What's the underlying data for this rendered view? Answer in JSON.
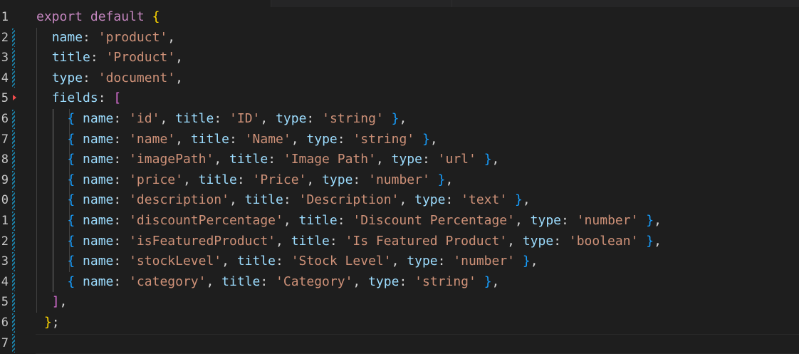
{
  "editor": {
    "language": "javascript",
    "line_numbers": [
      "1",
      "2",
      "3",
      "4",
      "5",
      "6",
      "7",
      "8",
      "9",
      "0",
      "1",
      "2",
      "3",
      "4",
      "5",
      "6",
      "7"
    ],
    "gutter_markers": [
      "none",
      "bar",
      "bar",
      "bar",
      "deleted",
      "bar",
      "bar",
      "bar",
      "bar",
      "bar",
      "bar",
      "bar",
      "bar",
      "bar",
      "bar",
      "bar",
      "bar"
    ],
    "current_line_index": 16,
    "lines": [
      [
        [
          "k",
          "export"
        ],
        [
          "pn",
          " "
        ],
        [
          "k",
          "default"
        ],
        [
          "pn",
          " "
        ],
        [
          "b1",
          "{"
        ]
      ],
      [
        [
          "pn",
          "  "
        ],
        [
          "p",
          "name"
        ],
        [
          "pn",
          ": "
        ],
        [
          "s",
          "'product'"
        ],
        [
          "pn",
          ","
        ]
      ],
      [
        [
          "pn",
          "  "
        ],
        [
          "p",
          "title"
        ],
        [
          "pn",
          ": "
        ],
        [
          "s",
          "'Product'"
        ],
        [
          "pn",
          ","
        ]
      ],
      [
        [
          "pn",
          "  "
        ],
        [
          "p",
          "type"
        ],
        [
          "pn",
          ": "
        ],
        [
          "s",
          "'document'"
        ],
        [
          "pn",
          ","
        ]
      ],
      [
        [
          "pn",
          "  "
        ],
        [
          "p",
          "fields"
        ],
        [
          "pn",
          ": "
        ],
        [
          "b2",
          "["
        ]
      ],
      [
        [
          "pn",
          "    "
        ],
        [
          "b3",
          "{"
        ],
        [
          "pn",
          " "
        ],
        [
          "p",
          "name"
        ],
        [
          "pn",
          ": "
        ],
        [
          "s",
          "'id'"
        ],
        [
          "pn",
          ", "
        ],
        [
          "p",
          "title"
        ],
        [
          "pn",
          ": "
        ],
        [
          "s",
          "'ID'"
        ],
        [
          "pn",
          ", "
        ],
        [
          "p",
          "type"
        ],
        [
          "pn",
          ": "
        ],
        [
          "s",
          "'string'"
        ],
        [
          "pn",
          " "
        ],
        [
          "b3",
          "}"
        ],
        [
          "pn",
          ","
        ]
      ],
      [
        [
          "pn",
          "    "
        ],
        [
          "b3",
          "{"
        ],
        [
          "pn",
          " "
        ],
        [
          "p",
          "name"
        ],
        [
          "pn",
          ": "
        ],
        [
          "s",
          "'name'"
        ],
        [
          "pn",
          ", "
        ],
        [
          "p",
          "title"
        ],
        [
          "pn",
          ": "
        ],
        [
          "s",
          "'Name'"
        ],
        [
          "pn",
          ", "
        ],
        [
          "p",
          "type"
        ],
        [
          "pn",
          ": "
        ],
        [
          "s",
          "'string'"
        ],
        [
          "pn",
          " "
        ],
        [
          "b3",
          "}"
        ],
        [
          "pn",
          ","
        ]
      ],
      [
        [
          "pn",
          "    "
        ],
        [
          "b3",
          "{"
        ],
        [
          "pn",
          " "
        ],
        [
          "p",
          "name"
        ],
        [
          "pn",
          ": "
        ],
        [
          "s",
          "'imagePath'"
        ],
        [
          "pn",
          ", "
        ],
        [
          "p",
          "title"
        ],
        [
          "pn",
          ": "
        ],
        [
          "s",
          "'Image Path'"
        ],
        [
          "pn",
          ", "
        ],
        [
          "p",
          "type"
        ],
        [
          "pn",
          ": "
        ],
        [
          "s",
          "'url'"
        ],
        [
          "pn",
          " "
        ],
        [
          "b3",
          "}"
        ],
        [
          "pn",
          ","
        ]
      ],
      [
        [
          "pn",
          "    "
        ],
        [
          "b3",
          "{"
        ],
        [
          "pn",
          " "
        ],
        [
          "p",
          "name"
        ],
        [
          "pn",
          ": "
        ],
        [
          "s",
          "'price'"
        ],
        [
          "pn",
          ", "
        ],
        [
          "p",
          "title"
        ],
        [
          "pn",
          ": "
        ],
        [
          "s",
          "'Price'"
        ],
        [
          "pn",
          ", "
        ],
        [
          "p",
          "type"
        ],
        [
          "pn",
          ": "
        ],
        [
          "s",
          "'number'"
        ],
        [
          "pn",
          " "
        ],
        [
          "b3",
          "}"
        ],
        [
          "pn",
          ","
        ]
      ],
      [
        [
          "pn",
          "    "
        ],
        [
          "b3",
          "{"
        ],
        [
          "pn",
          " "
        ],
        [
          "p",
          "name"
        ],
        [
          "pn",
          ": "
        ],
        [
          "s",
          "'description'"
        ],
        [
          "pn",
          ", "
        ],
        [
          "p",
          "title"
        ],
        [
          "pn",
          ": "
        ],
        [
          "s",
          "'Description'"
        ],
        [
          "pn",
          ", "
        ],
        [
          "p",
          "type"
        ],
        [
          "pn",
          ": "
        ],
        [
          "s",
          "'text'"
        ],
        [
          "pn",
          " "
        ],
        [
          "b3",
          "}"
        ],
        [
          "pn",
          ","
        ]
      ],
      [
        [
          "pn",
          "    "
        ],
        [
          "b3",
          "{"
        ],
        [
          "pn",
          " "
        ],
        [
          "p",
          "name"
        ],
        [
          "pn",
          ": "
        ],
        [
          "s",
          "'discountPercentage'"
        ],
        [
          "pn",
          ", "
        ],
        [
          "p",
          "title"
        ],
        [
          "pn",
          ": "
        ],
        [
          "s",
          "'Discount Percentage'"
        ],
        [
          "pn",
          ", "
        ],
        [
          "p",
          "type"
        ],
        [
          "pn",
          ": "
        ],
        [
          "s",
          "'number'"
        ],
        [
          "pn",
          " "
        ],
        [
          "b3",
          "}"
        ],
        [
          "pn",
          ","
        ]
      ],
      [
        [
          "pn",
          "    "
        ],
        [
          "b3",
          "{"
        ],
        [
          "pn",
          " "
        ],
        [
          "p",
          "name"
        ],
        [
          "pn",
          ": "
        ],
        [
          "s",
          "'isFeaturedProduct'"
        ],
        [
          "pn",
          ", "
        ],
        [
          "p",
          "title"
        ],
        [
          "pn",
          ": "
        ],
        [
          "s",
          "'Is Featured Product'"
        ],
        [
          "pn",
          ", "
        ],
        [
          "p",
          "type"
        ],
        [
          "pn",
          ": "
        ],
        [
          "s",
          "'boolean'"
        ],
        [
          "pn",
          " "
        ],
        [
          "b3",
          "}"
        ],
        [
          "pn",
          ","
        ]
      ],
      [
        [
          "pn",
          "    "
        ],
        [
          "b3",
          "{"
        ],
        [
          "pn",
          " "
        ],
        [
          "p",
          "name"
        ],
        [
          "pn",
          ": "
        ],
        [
          "s",
          "'stockLevel'"
        ],
        [
          "pn",
          ", "
        ],
        [
          "p",
          "title"
        ],
        [
          "pn",
          ": "
        ],
        [
          "s",
          "'Stock Level'"
        ],
        [
          "pn",
          ", "
        ],
        [
          "p",
          "type"
        ],
        [
          "pn",
          ": "
        ],
        [
          "s",
          "'number'"
        ],
        [
          "pn",
          " "
        ],
        [
          "b3",
          "}"
        ],
        [
          "pn",
          ","
        ]
      ],
      [
        [
          "pn",
          "    "
        ],
        [
          "b3",
          "{"
        ],
        [
          "pn",
          " "
        ],
        [
          "p",
          "name"
        ],
        [
          "pn",
          ": "
        ],
        [
          "s",
          "'category'"
        ],
        [
          "pn",
          ", "
        ],
        [
          "p",
          "title"
        ],
        [
          "pn",
          ": "
        ],
        [
          "s",
          "'Category'"
        ],
        [
          "pn",
          ", "
        ],
        [
          "p",
          "type"
        ],
        [
          "pn",
          ": "
        ],
        [
          "s",
          "'string'"
        ],
        [
          "pn",
          " "
        ],
        [
          "b3",
          "}"
        ],
        [
          "pn",
          ","
        ]
      ],
      [
        [
          "pn",
          "  "
        ],
        [
          "b2",
          "]"
        ],
        [
          "pn",
          ","
        ]
      ],
      [
        [
          "pn",
          " "
        ],
        [
          "b1",
          "}"
        ],
        [
          "pn",
          ";"
        ]
      ],
      []
    ]
  },
  "colors": {
    "background": "#1e1e1e",
    "keyword": "#c586c0",
    "property": "#9cdcfe",
    "string": "#ce9178",
    "punctuation": "#d4d4d4",
    "bracket_level1": "#ffd700",
    "bracket_level2": "#da70d6",
    "bracket_level3": "#179fff",
    "git_modified": "#1b81a8",
    "git_deleted": "#f14c4c"
  }
}
